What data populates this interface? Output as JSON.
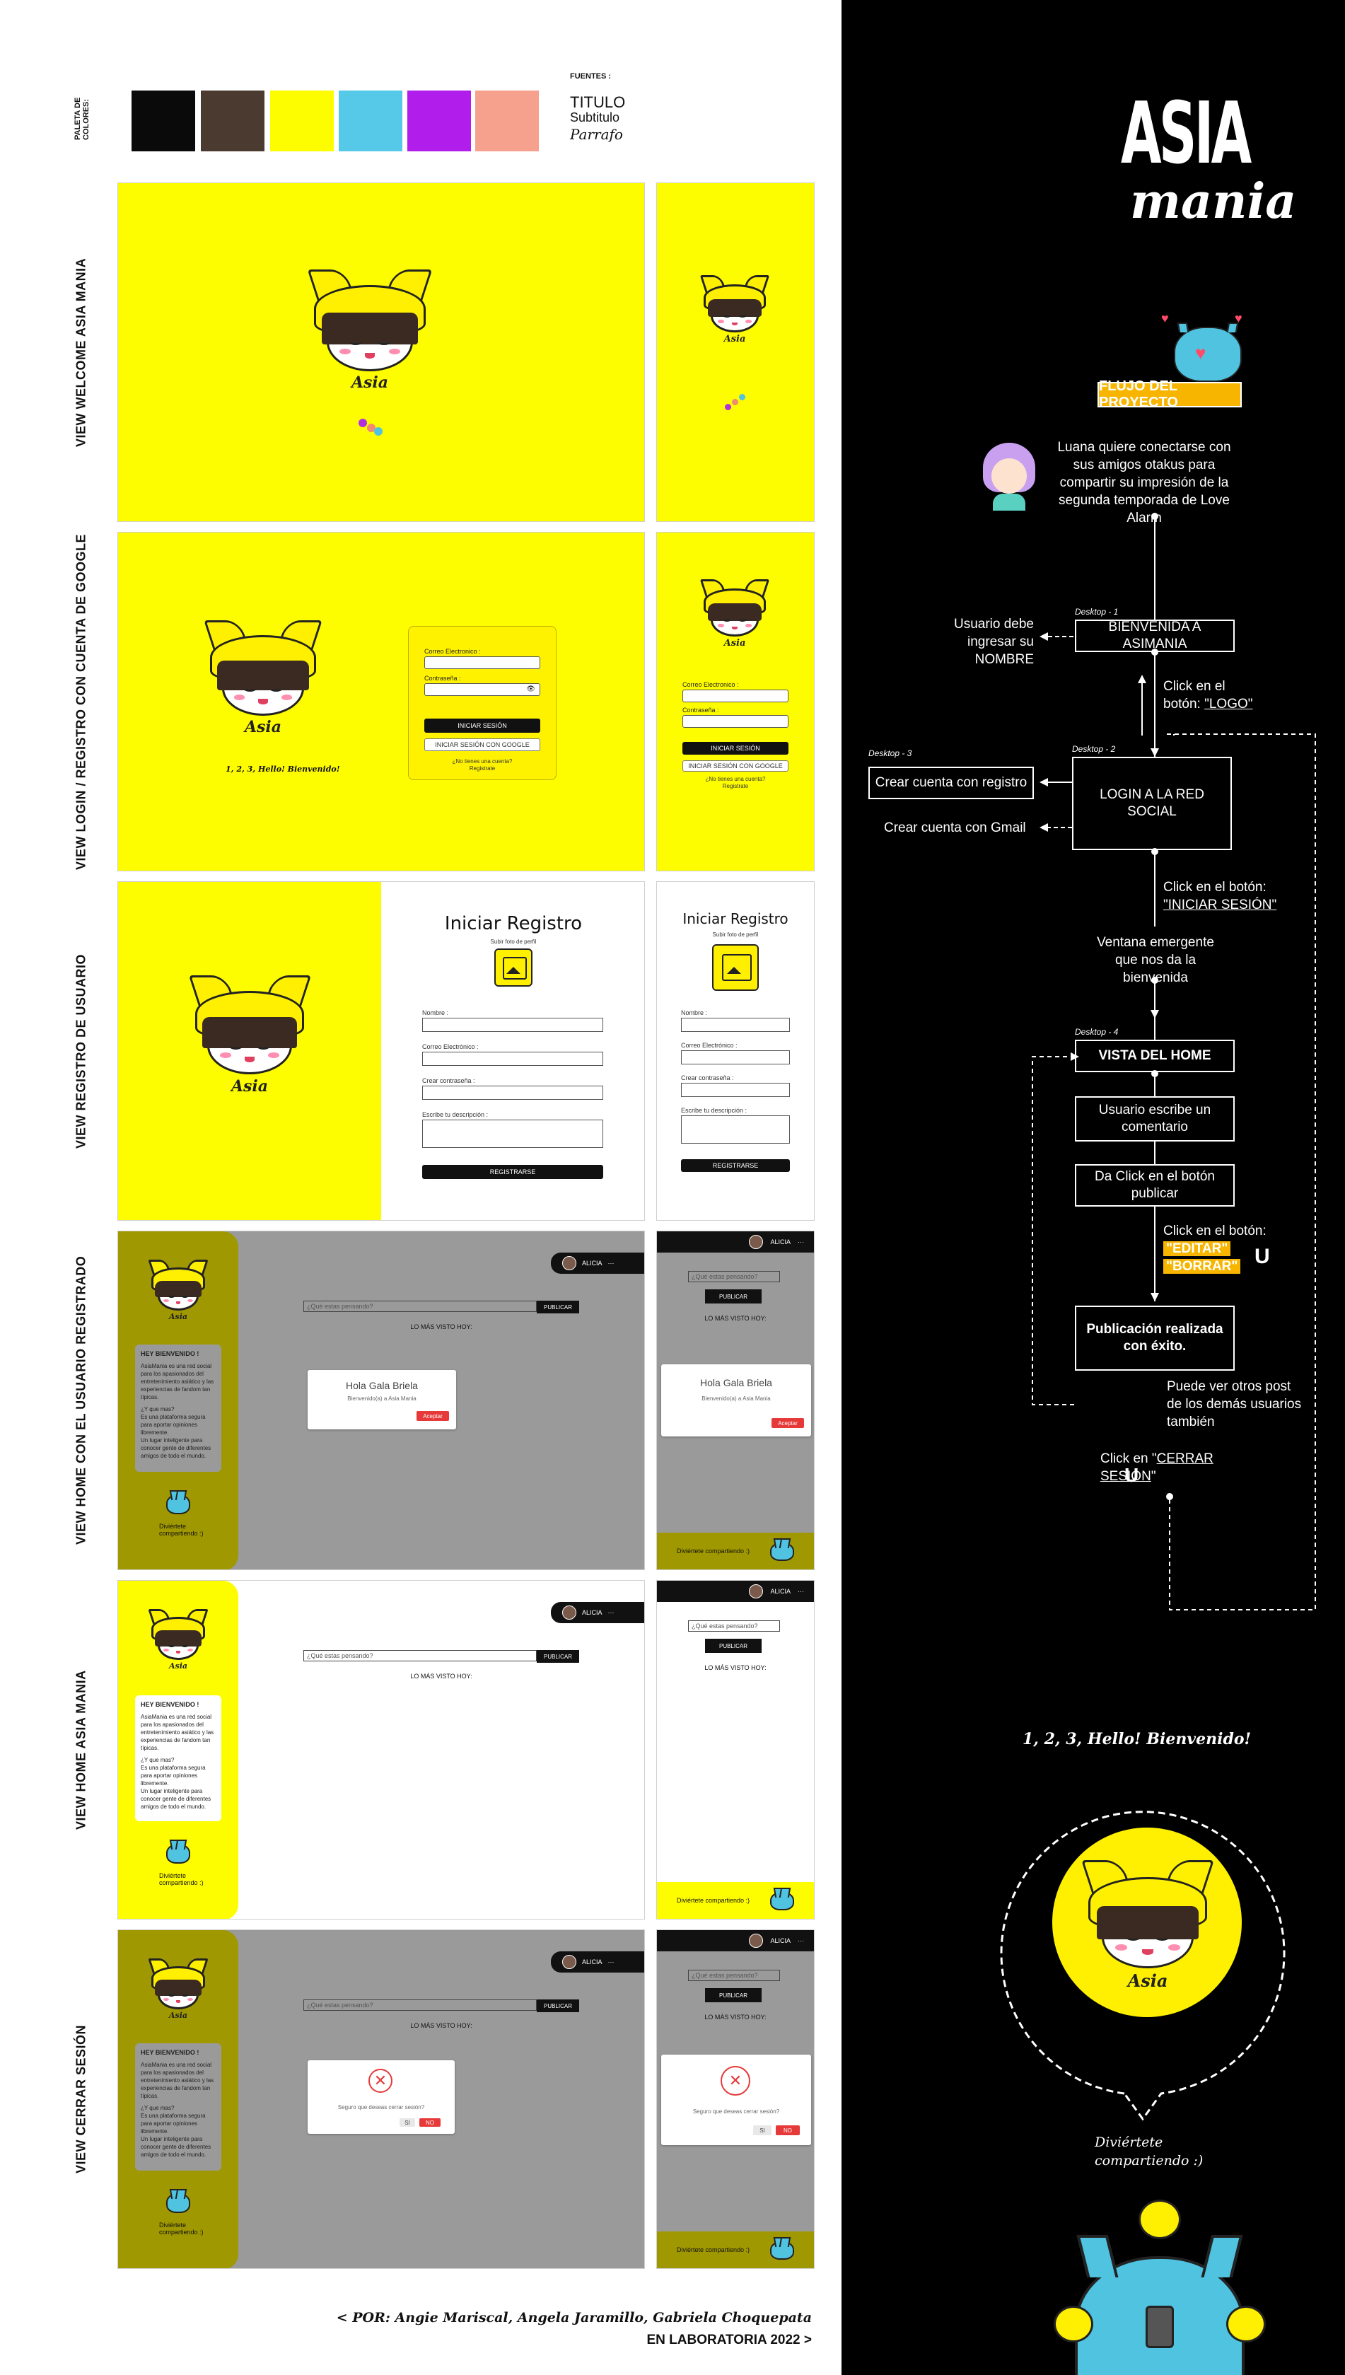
{
  "palette": {
    "label": "PALETA DE COLORES:",
    "colors": [
      "#0a0a0a",
      "#4b3a30",
      "#FEFD00",
      "#57C9E8",
      "#B11EEB",
      "#F6A08E"
    ]
  },
  "fonts": {
    "label": "FUENTES :",
    "title": "TITULO",
    "subtitle": "Subtitulo",
    "paragraph": "Parrafo"
  },
  "rows": {
    "welcome": "VIEW WELCOME ASIA MANIA",
    "login": "VIEW LOGIN / REGISTRO CON CUENTA DE GOOGLE",
    "registro": "VIEW REGISTRO DE USUARIO",
    "home_registrado": "VIEW HOME CON EL USUARIO REGISTRADO",
    "home": "VIEW HOME  ASIA MANIA",
    "cerrar": "VIEW CERRAR SESIÓN"
  },
  "mascot": {
    "logo": "Asia",
    "logo_sub": "mania",
    "icon": "cat-girl-mascot-icon"
  },
  "login": {
    "email_label": "Correo Electronico :",
    "password_label": "Contraseña :",
    "login_button": "INICIAR SESIÓN",
    "google_button": "INICIAR SESIÓN CON GOOGLE",
    "no_account": "¿No tienes una cuenta?",
    "register_link": "Registrate",
    "hello": "1, 2, 3, Hello! Bienvenido!"
  },
  "registro": {
    "title": "Iniciar Registro",
    "photo_label": "Subir foto de perfil",
    "name_label": "Nombre :",
    "email_label": "Correo Electrónico :",
    "password_label": "Crear contraseña :",
    "desc_label": "Escribe tu descripción :",
    "register_button": "REGISTRARSE"
  },
  "home": {
    "user": "ALICIA",
    "menu": "···",
    "post_placeholder": "¿Qué estas pensando?",
    "publish": "PUBLICAR",
    "most_viewed": "LO MÁS VISTO HOY:",
    "welcome_title": "HEY BIENVENIDO !",
    "welcome_line1": "AsiaMania es una red social para los apasionados del entretenimiento asiático y las experiencias de fandom tan típicas.",
    "welcome_line2": "¿Y que mas?",
    "welcome_line3": "Es una plataforma segura para aportar opiniones libremente.",
    "welcome_line4": "Un lugar inteligente para conocer gente de diferentes amigos de todo el mundo.",
    "share": "Diviértete compartiendo :)",
    "modal_title": "Hola Gala Briela",
    "modal_sub": "Bienvenido(a) a Asia Mania",
    "accept": "Aceptar",
    "logout_question": "Seguro que deseas cerrar sesión?",
    "yes": "SI",
    "no": "NO"
  },
  "credits": {
    "line1": "< POR: Angie Mariscal, Angela Jaramillo, Gabriela Choquepata",
    "line2": "EN LABORATORIA  2022 >"
  },
  "brand": {
    "line1": "ASIA",
    "line2": "mania"
  },
  "flow": {
    "title": "FLUJO DEL PROYECTO",
    "intro": "Luana quiere conectarse con sus amigos otakus para compartir su impresión de la segunda temporada de Love Alarm",
    "d1_tag": "Desktop - 1",
    "d1": "BIENVENIDA A ASIMANIA",
    "d1_note": "Usuario debe ingresar su NOMBRE",
    "click_logo_a": "Click en el botón: ",
    "click_logo_b": "\"LOGO\"",
    "d2_tag": "Desktop - 2",
    "d2": "LOGIN A LA RED SOCIAL",
    "d3_tag": "Desktop - 3",
    "d3": "Crear cuenta con registro",
    "gmail": "Crear cuenta con Gmail",
    "click_login_a": "Click en el botón:",
    "click_login_b": "\"INICIAR SESIÓN\"",
    "ventana": "Ventana emergente que nos da la bienvenida",
    "d4_tag": "Desktop - 4",
    "d4": "VISTA DEL HOME",
    "escribe": "Usuario escribe  un comentario",
    "publicar": "Da Click en el botón publicar",
    "click_edit": "Click en el botón:",
    "editar": "\"EDITAR\"",
    "borrar": "\"BORRAR\"",
    "publicacion": "Publicación realizada con éxito.",
    "ver_post": "Puede ver otros post de los demás usuarios también",
    "cerrar_a": "Click en \"",
    "cerrar_b": "CERRAR SESIÓN",
    "cerrar_c": "\""
  },
  "hello_big": "1, 2, 3, Hello! Bienvenido!",
  "diviertete_1": "Diviértete",
  "diviertete_2": "compartiendo :)"
}
